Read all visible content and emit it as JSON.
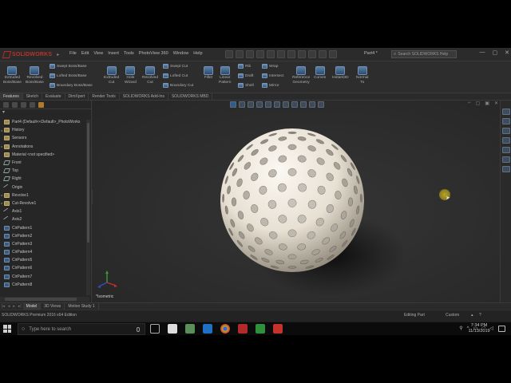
{
  "app": {
    "brand": "SOLIDWORKS",
    "menus": [
      "File",
      "Edit",
      "View",
      "Insert",
      "Tools",
      "PhotoView 360",
      "Window",
      "Help"
    ],
    "doc_title": "Part4 *",
    "search_placeholder": "Search SOLIDWORKS Help",
    "window_controls": [
      "—",
      "▢",
      "✕"
    ]
  },
  "ribbon": {
    "buttons": [
      {
        "label": "Extruded\nBoss/Base",
        "icon": "extruded-boss-icon"
      },
      {
        "label": "Revolved\nBoss/Base",
        "icon": "revolved-boss-icon"
      },
      {
        "label": "Extruded\nCut",
        "icon": "extruded-cut-icon"
      },
      {
        "label": "Hole\nWizard",
        "icon": "hole-wizard-icon"
      },
      {
        "label": "Revolved\nCut",
        "icon": "revolved-cut-icon"
      },
      {
        "label": "Fillet",
        "icon": "fillet-icon"
      },
      {
        "label": "Linear\nPattern",
        "icon": "linear-pattern-icon"
      },
      {
        "label": "Reference\nGeometry",
        "icon": "reference-geometry-icon"
      },
      {
        "label": "Curves",
        "icon": "curves-icon"
      },
      {
        "label": "Instant3D",
        "icon": "instant3d-icon"
      },
      {
        "label": "Normal\nTo",
        "icon": "normal-to-icon"
      }
    ],
    "small_buttons": [
      "Swept Boss/Base",
      "Lofted Boss/Base",
      "Boundary Boss/Base",
      "Swept Cut",
      "Lofted Cut",
      "Boundary Cut",
      "Rib",
      "Draft",
      "Shell",
      "Wrap",
      "Intersect",
      "Mirror"
    ]
  },
  "tabs": [
    "Features",
    "Sketch",
    "Evaluate",
    "DimXpert",
    "Render Tools",
    "SOLIDWORKS Add-Ins",
    "SOLIDWORKS MBD"
  ],
  "tree": {
    "root": "Part4 (Default<<Default>_PhotoWorks",
    "items": [
      {
        "label": "History",
        "type": "feat",
        "expand": "▸"
      },
      {
        "label": "Sensors",
        "type": "feat",
        "expand": ""
      },
      {
        "label": "Annotations",
        "type": "feat",
        "expand": "▸"
      },
      {
        "label": "Material <not specified>",
        "type": "feat",
        "expand": ""
      },
      {
        "label": "Front",
        "type": "plane",
        "expand": ""
      },
      {
        "label": "Top",
        "type": "plane",
        "expand": ""
      },
      {
        "label": "Right",
        "type": "plane",
        "expand": ""
      },
      {
        "label": "Origin",
        "type": "axis",
        "expand": ""
      },
      {
        "label": "Revolve1",
        "type": "feat",
        "expand": "▸"
      },
      {
        "label": "Cut-Revolve1",
        "type": "feat",
        "expand": "▸"
      },
      {
        "label": "Axis1",
        "type": "axis",
        "expand": ""
      },
      {
        "label": "Axis2",
        "type": "axis",
        "expand": ""
      },
      {
        "label": "CirPattern1",
        "type": "pattern",
        "expand": ""
      },
      {
        "label": "CirPattern2",
        "type": "pattern",
        "expand": ""
      },
      {
        "label": "CirPattern3",
        "type": "pattern",
        "expand": ""
      },
      {
        "label": "CirPattern4",
        "type": "pattern",
        "expand": ""
      },
      {
        "label": "CirPattern5",
        "type": "pattern",
        "expand": ""
      },
      {
        "label": "CirPattern6",
        "type": "pattern",
        "expand": ""
      },
      {
        "label": "CirPattern7",
        "type": "pattern",
        "expand": ""
      },
      {
        "label": "CirPattern8",
        "type": "pattern",
        "expand": ""
      }
    ]
  },
  "viewport": {
    "view_label": "*Isometric"
  },
  "bottom_tabs": [
    "Model",
    "3D Views",
    "Motion Study 1"
  ],
  "status": {
    "edition": "SOLIDWORKS Premium 2016 x64 Edition",
    "mode": "Editing Part",
    "units": "Custom",
    "help": "?"
  },
  "taskbar": {
    "search_placeholder": "Type here to search",
    "time": "7:34 PM",
    "date": "11/13/2019"
  },
  "colors": {
    "accent": "#b8332b",
    "cursor_highlight": "#b9a42a",
    "ball": "#f1ece3"
  }
}
